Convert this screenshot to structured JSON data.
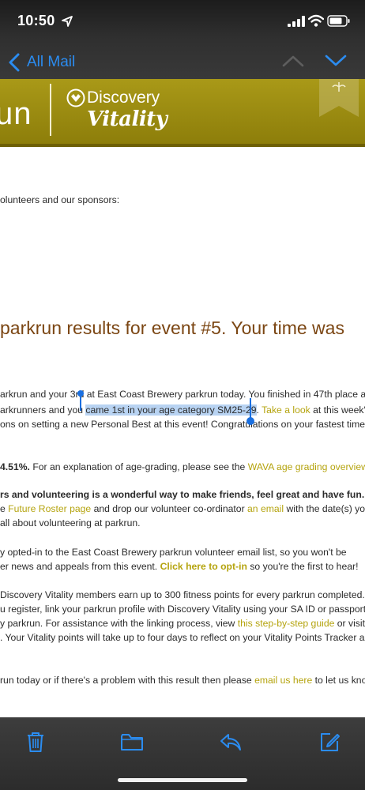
{
  "status_bar": {
    "time": "10:50"
  },
  "nav": {
    "back_label": "All Mail"
  },
  "banner": {
    "parkrun_text": "un",
    "discovery_text": "Discovery",
    "vitality_text": "Vitality"
  },
  "email": {
    "greeting_line": "olunteers and our sponsors:",
    "heading": "parkrun results for event #5. Your time was",
    "result": {
      "line1": "arkrun and your 3rd at East Coast Brewery parkrun today. You finished in 47th place and",
      "line2_pre": "arkrunners and you ",
      "line2_selected": "came 1st in your age category SM25-29",
      "line2_post_space": ". ",
      "line2_link": "Take a look",
      "line2_end": " at this week's f",
      "line3": "ons on setting a new Personal Best at this event! Congratulations on your fastest time t"
    },
    "age_grade": {
      "value": "4.51%.",
      "text": " For an explanation of age-grading, please see the ",
      "link": "WAVA age grading overview",
      "end": "."
    },
    "volunteer": {
      "line1_bold": "rs and volunteering is a wonderful way to make friends, feel great and have fun.",
      "line1_end": " It",
      "line2_pre": "e ",
      "line2_link1": "Future Roster page",
      "line2_mid": " and drop our volunteer co-ordinator ",
      "line2_link2": "an email",
      "line2_end": " with the date(s) you'",
      "line3": " all about volunteering at parkrun."
    },
    "optin": {
      "line1": "y opted-in to the East Coast Brewery parkrun volunteer email list, so you won't be",
      "line2_pre": "er news and appeals from this event. ",
      "line2_link": "Click here to opt-in",
      "line2_end": " so you're the first to hear!"
    },
    "vitality": {
      "line1": "Discovery Vitality members earn up to 300 fitness points for every parkrun completed.",
      "line2": "u register, link your parkrun profile with Discovery Vitality using your SA ID or passport",
      "line3_pre": "y parkrun. For assistance with the linking process, view ",
      "line3_link": "this step-by-step guide",
      "line3_end": " or visit",
      "line4": ". Your Vitality points will take up to four days to reflect on your Vitality Points Tracker as"
    },
    "problem": {
      "line_pre": "run today or if there's a problem with this result then please ",
      "line_link": "email us here",
      "line_end": " to let us know"
    }
  },
  "toolbar": {
    "items": [
      "trash-icon",
      "folder-icon",
      "reply-icon",
      "compose-icon"
    ]
  },
  "colors": {
    "accent_blue": "#2b8cf0",
    "link_olive": "#b5a40f",
    "heading_brown": "#7b4613",
    "banner_olive": "#9b8c12"
  }
}
